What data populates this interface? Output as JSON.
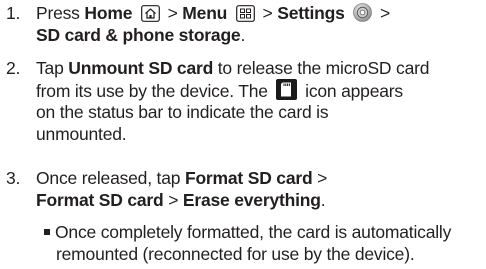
{
  "steps": [
    {
      "number": "1.",
      "text_press": "Press",
      "home": "Home",
      "sep1": ">",
      "menu": "Menu",
      "sep2": ">",
      "settings": "Settings",
      "sep3": ">",
      "target": "SD card & phone storage",
      "end": "."
    },
    {
      "number": "2.",
      "text_tap": "Tap",
      "unmount": "Unmount SD card",
      "rest1": "to release the microSD card",
      "line2a": "from its use by the device. The",
      "line2b": "icon appears",
      "line3": "on the status bar to indicate the card is",
      "line4": "unmounted."
    },
    {
      "number": "3.",
      "text_once": "Once released, tap",
      "format1": "Format SD card",
      "sep": ">",
      "format2": "Format SD card",
      "sep2": ">",
      "erase": "Erase everything",
      "end": "."
    }
  ],
  "note": {
    "line1": "Once completely formatted, the card is automatically",
    "line2": "remounted (reconnected for use by the device)."
  },
  "icons": [
    "home-key-icon",
    "menu-key-icon",
    "settings-gear-icon",
    "sd-unmounted-status-icon"
  ]
}
